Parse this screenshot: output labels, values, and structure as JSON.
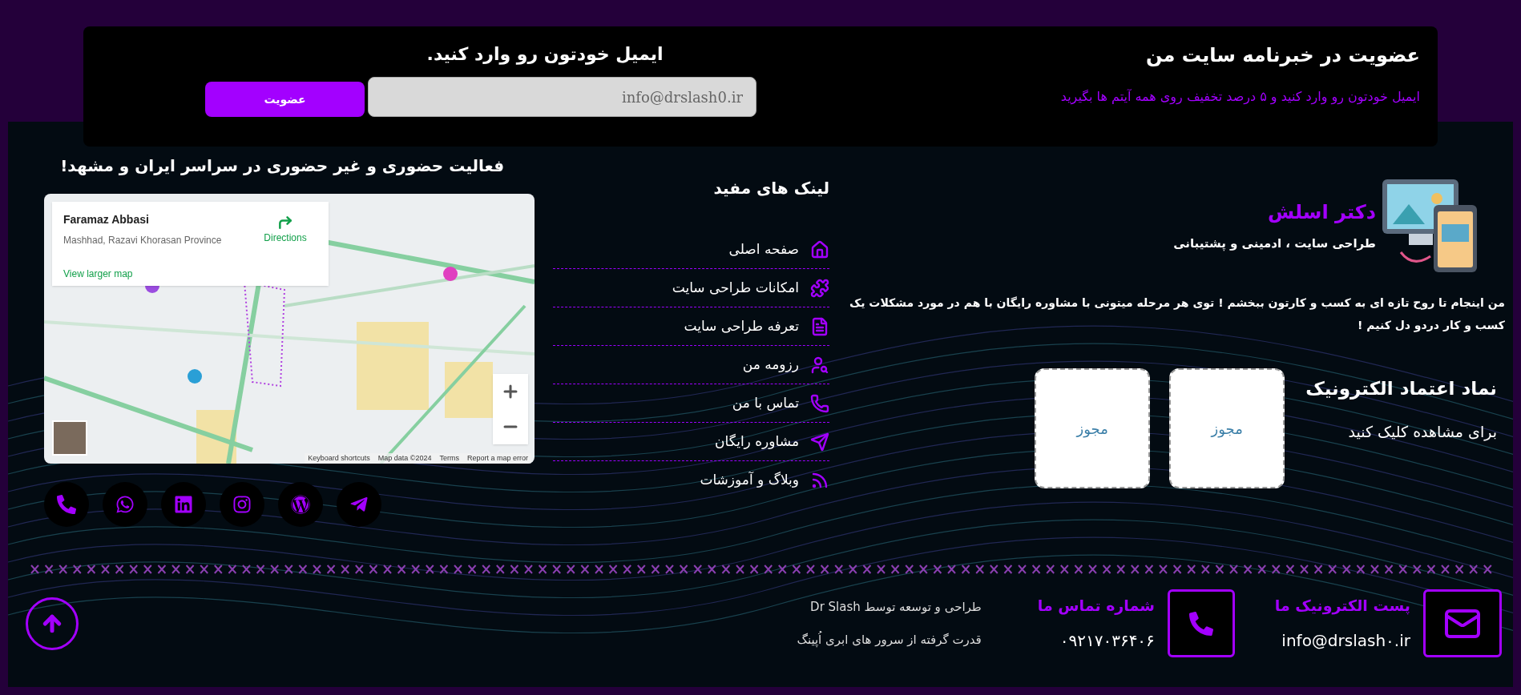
{
  "newsletter": {
    "title": "عضویت در خبرنامه سایت من",
    "subtitle": "ایمیل خودتون رو وارد کنید و ۵ درصد تخفیف روی همه آیتم ها بگیرید",
    "prompt": "ایمیل خودتون رو وارد کنید.",
    "email_field": {
      "placeholder": "info@drslash0.ir"
    },
    "button": "عضویت"
  },
  "map_section": {
    "heading": "فعالیت حضوری و غیر حضوری در سراسر ایران و مشهد!",
    "map": {
      "kind": "picture",
      "place_name": "Faramaz Abbasi",
      "address": "Mashhad, Razavi Khorasan Province",
      "directions": "Directions",
      "larger_map_link": "View larger map",
      "attribution": [
        "Report a map error",
        "Terms",
        "Map data ©2024",
        "Keyboard shortcuts"
      ]
    }
  },
  "social_links": [
    {
      "kind": "phone"
    },
    {
      "kind": "whatsapp"
    },
    {
      "kind": "linkedin"
    },
    {
      "kind": "instagram"
    },
    {
      "kind": "wordpress"
    },
    {
      "kind": "telegram"
    }
  ],
  "useful_links": {
    "heading": "لینک های مفید",
    "items": [
      {
        "label": "صفحه اصلی",
        "kind": "home"
      },
      {
        "label": "امکانات طراحی سایت",
        "kind": "puzzle"
      },
      {
        "label": "تعرفه طراحی سایت",
        "kind": "document"
      },
      {
        "label": "رزومه من",
        "kind": "user"
      },
      {
        "label": "تماس با من",
        "kind": "phone"
      },
      {
        "label": "مشاوره رایگان",
        "kind": "telegram"
      },
      {
        "label": "وبلاگ و آموزشات",
        "kind": "feed"
      }
    ]
  },
  "brand": {
    "name": "دکتر اسلش",
    "tagline": "طراحی سایت ، ادمینی و پشتیبانی",
    "description": "من اینجام تا روح تازه ای به کسب و کارتون ببخشم ! توی هر مرحله میتونی با مشاوره رایگان با هم در مورد مشکلات یک کسب و کار دردو دل کنیم !"
  },
  "trust": {
    "title": "نماد اعتماد الکترونیک",
    "subtitle": "برای مشاهده کلیک کنید",
    "badges": [
      "مجوز",
      "مجوز"
    ]
  },
  "contacts": [
    {
      "kind": "email",
      "label": "پست الکترونیک ما",
      "value": "info@drslash۰.ir"
    },
    {
      "kind": "phone",
      "label": "شماره تماس ما",
      "value": "۰۹۲۱۷۰۳۶۴۰۶"
    }
  ],
  "credits": [
    "طراحی و توسعه توسط Dr Slash",
    "قدرت گرفته از سرور های ابری اُپینگ"
  ]
}
